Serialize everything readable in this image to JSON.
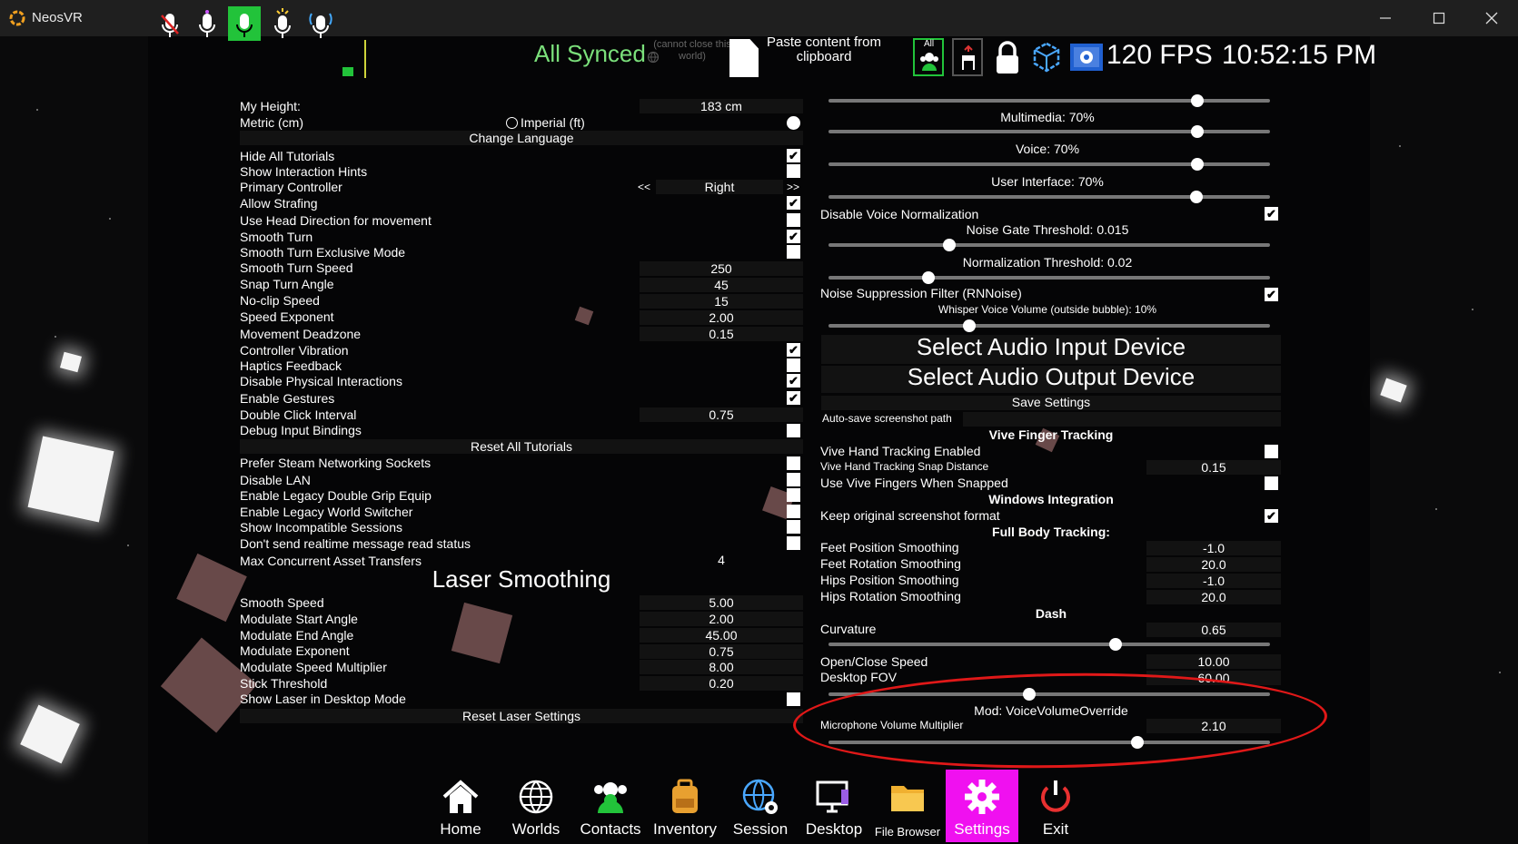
{
  "window": {
    "title": "NeosVR",
    "min_icon": "minimize-icon",
    "max_icon": "maximize-icon",
    "close_icon": "close-icon"
  },
  "topbar": {
    "mic_icons": [
      "mic-muted-icon",
      "mic-icon",
      "mic-broadcast-icon",
      "mic-sparkle-icon",
      "mic-waves-icon"
    ],
    "sync_status": "All Synced",
    "cannot_close": "(cannot close this world)",
    "paste_content": "Paste content from clipboard",
    "all_label": "All",
    "fps": "120 FPS",
    "clock": "10:52:15 PM"
  },
  "left": {
    "my_height_label": "My Height:",
    "my_height_value": "183 cm",
    "metric_label": "Metric (cm)",
    "imperial_label": "Imperial (ft)",
    "change_language": "Change Language",
    "hide_all_tutorials": "Hide All Tutorials",
    "show_interaction_hints": "Show Interaction Hints",
    "primary_controller": "Primary Controller",
    "primary_controller_prev": "<<",
    "primary_controller_value": "Right",
    "primary_controller_next": ">>",
    "allow_strafing": "Allow Strafing",
    "head_direction": "Use Head Direction for movement",
    "smooth_turn": "Smooth Turn",
    "smooth_turn_exclusive": "Smooth Turn Exclusive Mode",
    "smooth_turn_speed": "Smooth Turn Speed",
    "smooth_turn_speed_value": "250",
    "snap_turn_angle": "Snap Turn Angle",
    "snap_turn_angle_value": "45",
    "noclip_speed": "No-clip Speed",
    "noclip_speed_value": "15",
    "speed_exponent": "Speed Exponent",
    "speed_exponent_value": "2.00",
    "movement_deadzone": "Movement Deadzone",
    "movement_deadzone_value": "0.15",
    "controller_vibration": "Controller Vibration",
    "haptics_feedback": "Haptics Feedback",
    "disable_physical": "Disable Physical Interactions",
    "enable_gestures": "Enable Gestures",
    "double_click": "Double Click Interval",
    "double_click_value": "0.75",
    "debug_input": "Debug Input Bindings",
    "reset_tutorials": "Reset All Tutorials",
    "prefer_steam": "Prefer Steam Networking Sockets",
    "disable_lan": "Disable LAN",
    "legacy_double_grip": "Enable Legacy Double Grip Equip",
    "legacy_world_switcher": "Enable Legacy World Switcher",
    "show_incompatible": "Show Incompatible Sessions",
    "dont_send_read": "Don't send realtime message read status",
    "max_concurrent": "Max Concurrent Asset Transfers",
    "max_concurrent_value": "4",
    "laser_smoothing": "Laser Smoothing",
    "smooth_speed": "Smooth Speed",
    "smooth_speed_value": "5.00",
    "mod_start_angle": "Modulate Start Angle",
    "mod_start_angle_value": "2.00",
    "mod_end_angle": "Modulate End Angle",
    "mod_end_angle_value": "45.00",
    "mod_exponent": "Modulate Exponent",
    "mod_exponent_value": "0.75",
    "mod_speed_mult": "Modulate Speed Multiplier",
    "mod_speed_mult_value": "8.00",
    "stick_threshold": "Stick Threshold",
    "stick_threshold_value": "0.20",
    "show_laser_desktop": "Show Laser in Desktop Mode",
    "reset_laser": "Reset Laser Settings"
  },
  "right": {
    "multimedia": "Multimedia: 70%",
    "voice": "Voice: 70%",
    "user_interface": "User Interface: 70%",
    "disable_voice_norm": "Disable Voice Normalization",
    "noise_gate": "Noise Gate Threshold: 0.015",
    "normalization": "Normalization Threshold: 0.02",
    "noise_suppression": "Noise Suppression Filter (RNNoise)",
    "whisper_volume": "Whisper Voice Volume (outside bubble): 10%",
    "select_input": "Select Audio Input Device",
    "select_output": "Select Audio Output Device",
    "save_settings": "Save Settings",
    "autosave_path": "Auto-save screenshot path",
    "vive_finger": "Vive Finger Tracking",
    "vive_hand_enabled": "Vive Hand Tracking Enabled",
    "vive_snap_distance": "Vive Hand Tracking Snap Distance",
    "vive_snap_distance_value": "0.15",
    "use_vive_fingers": "Use Vive Fingers When Snapped",
    "windows_integration": "Windows Integration",
    "keep_screenshot": "Keep original screenshot format",
    "full_body": "Full Body Tracking:",
    "feet_pos": "Feet Position Smoothing",
    "feet_pos_value": "-1.0",
    "feet_rot": "Feet Rotation Smoothing",
    "feet_rot_value": "20.0",
    "hips_pos": "Hips Position Smoothing",
    "hips_pos_value": "-1.0",
    "hips_rot": "Hips Rotation Smoothing",
    "hips_rot_value": "20.0",
    "dash": "Dash",
    "curvature": "Curvature",
    "curvature_value": "0.65",
    "open_close": "Open/Close Speed",
    "open_close_value": "10.00",
    "desktop_fov": "Desktop FOV",
    "desktop_fov_value": "60.00",
    "mod_title": "Mod: VoiceVolumeOverride",
    "mic_mult": "Microphone Volume Multiplier",
    "mic_mult_value": "2.10"
  },
  "nav": [
    {
      "label": "Home",
      "icon": "home-icon"
    },
    {
      "label": "Worlds",
      "icon": "globe-icon"
    },
    {
      "label": "Contacts",
      "icon": "contacts-icon"
    },
    {
      "label": "Inventory",
      "icon": "backpack-icon"
    },
    {
      "label": "Session",
      "icon": "session-globe-gear-icon"
    },
    {
      "label": "Desktop",
      "icon": "desktop-icon"
    },
    {
      "label": "File Browser",
      "icon": "folder-icon"
    },
    {
      "label": "Settings",
      "icon": "gear-icon"
    },
    {
      "label": "Exit",
      "icon": "power-icon"
    }
  ],
  "colors": {
    "active_green": "#22c33a",
    "active_magenta": "#f010f0",
    "synced_text": "#7be07b",
    "annotation_red": "#e01818"
  }
}
